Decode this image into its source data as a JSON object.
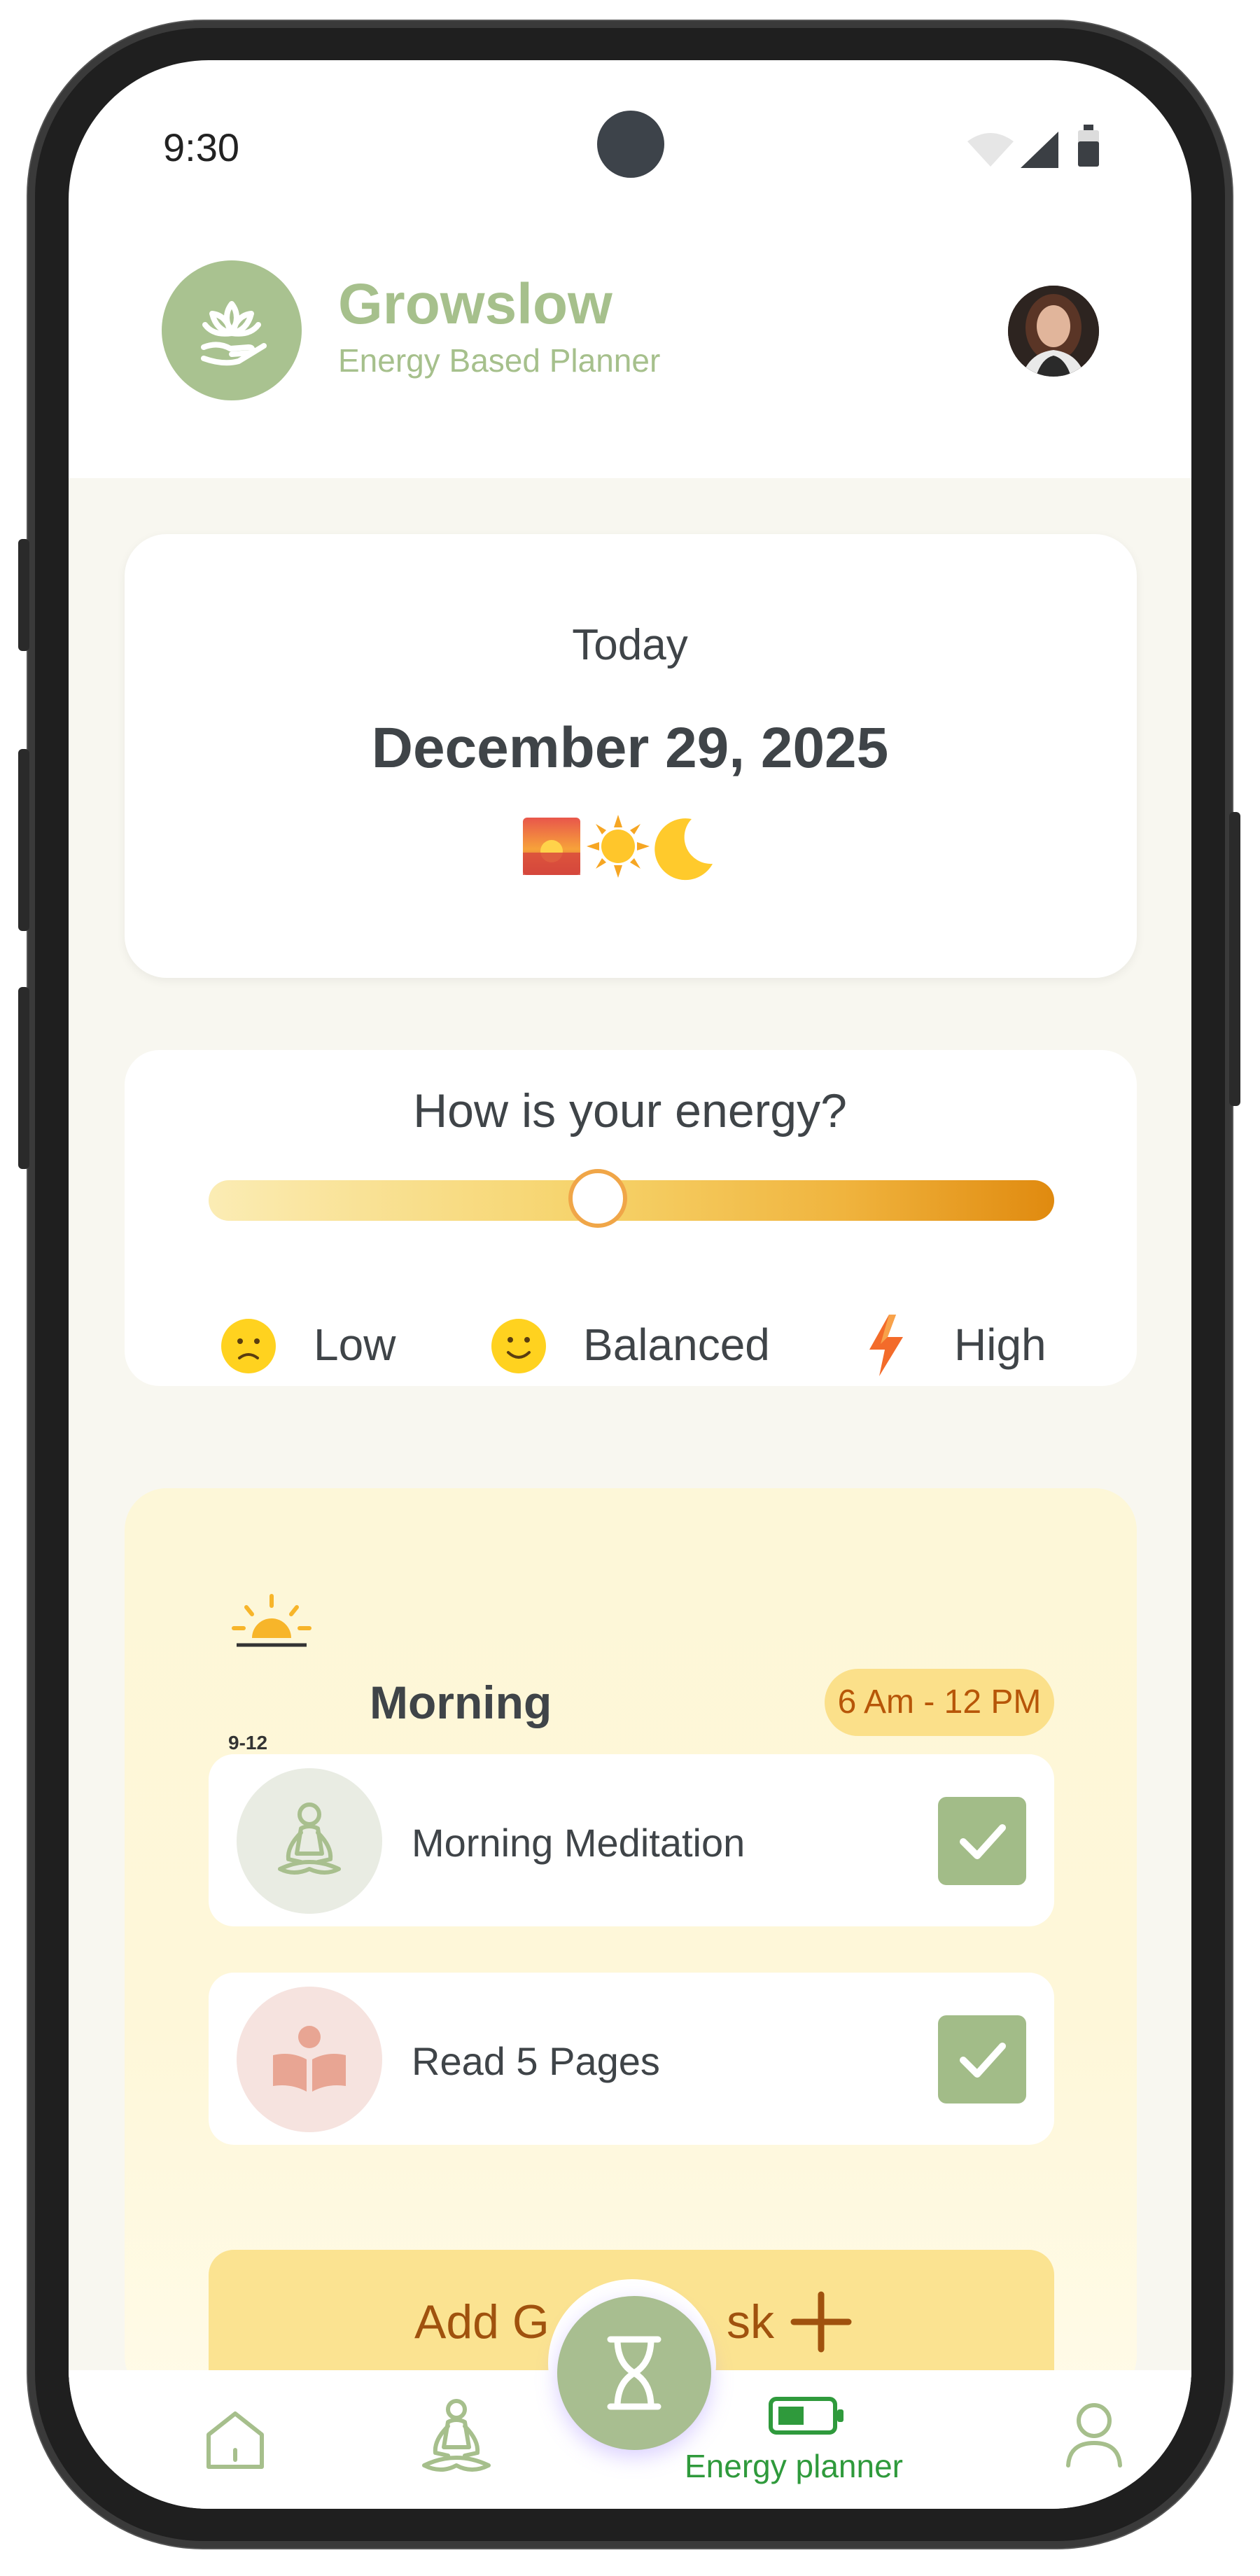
{
  "status_bar": {
    "time": "9:30"
  },
  "header": {
    "app_name": "Growslow",
    "app_subtitle": "Energy Based Planner"
  },
  "date_card": {
    "label": "Today",
    "date": "December 29, 2025",
    "icons": [
      "sunrise-icon",
      "sun-icon",
      "crescent-moon-icon"
    ]
  },
  "energy": {
    "title": "How is your energy?",
    "level": 0.46,
    "options": [
      {
        "label": "Low",
        "icon": "slightly-frowning-face-icon"
      },
      {
        "label": "Balanced",
        "icon": "slightly-smiling-face-icon"
      },
      {
        "label": "High",
        "icon": "lightning-bolt-icon"
      }
    ],
    "colors": {
      "track_start": "#fbecb4",
      "track_end": "#e08a0f"
    }
  },
  "morning": {
    "title": "Morning",
    "time_range": "6 Am - 12 PM",
    "icon_caption": "9-12",
    "tasks": [
      {
        "label": "Morning Meditation",
        "icon": "meditation-icon",
        "done": true
      },
      {
        "label": "Read 5 Pages",
        "icon": "open-book-icon",
        "done": true
      }
    ],
    "add_task_left": "Add G",
    "add_task_right": "sk"
  },
  "bottom_nav": {
    "items": [
      {
        "icon": "home-icon"
      },
      {
        "icon": "meditation-icon"
      },
      {
        "icon": "hourglass-icon"
      },
      {
        "icon": "battery-icon",
        "label": "Energy planner"
      },
      {
        "icon": "user-icon"
      }
    ]
  },
  "colors": {
    "brand_green": "#a9c290",
    "accent_orange": "#b75608",
    "active_green": "#2f9a3c"
  }
}
